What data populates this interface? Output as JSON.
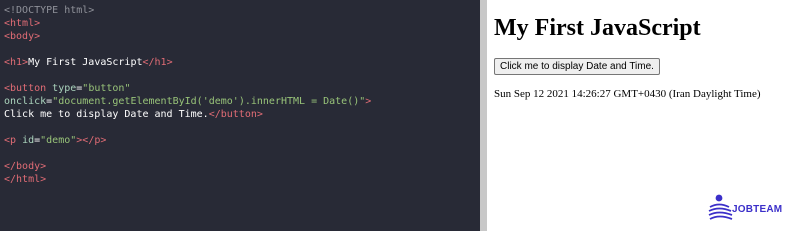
{
  "editor": {
    "lines": {
      "doctype": "<!DOCTYPE html>",
      "html_open": "<html>",
      "body_open": "<body>",
      "h1_open": "<h1>",
      "h1_text": "My First JavaScript",
      "h1_close": "</h1>",
      "button_open_start": "<button",
      "button_type_attr": " type",
      "button_type_eq": "=",
      "button_type_val": "\"button\"",
      "onclick_attr": "onclick",
      "onclick_eq": "=",
      "onclick_val": "\"document.getElementById('demo').innerHTML = Date()\"",
      "onclick_close": ">",
      "button_text": "Click me to display Date and Time.",
      "button_close": "</button>",
      "p_open": "<p",
      "p_id_attr": " id",
      "p_eq": "=",
      "p_id_val": "\"demo\"",
      "p_open_end": ">",
      "p_close": "</p>",
      "body_close": "</body>",
      "html_close": "</html>"
    },
    "background": "#282a36"
  },
  "preview": {
    "heading": "My First JavaScript",
    "button_label": "Click me to display Date and Time.",
    "output_text": "Sun Sep 12 2021 14:26:27 GMT+0430 (Iran Daylight Time)"
  },
  "logo": {
    "text": "JOBTEAM",
    "color": "#3b2fc9"
  }
}
